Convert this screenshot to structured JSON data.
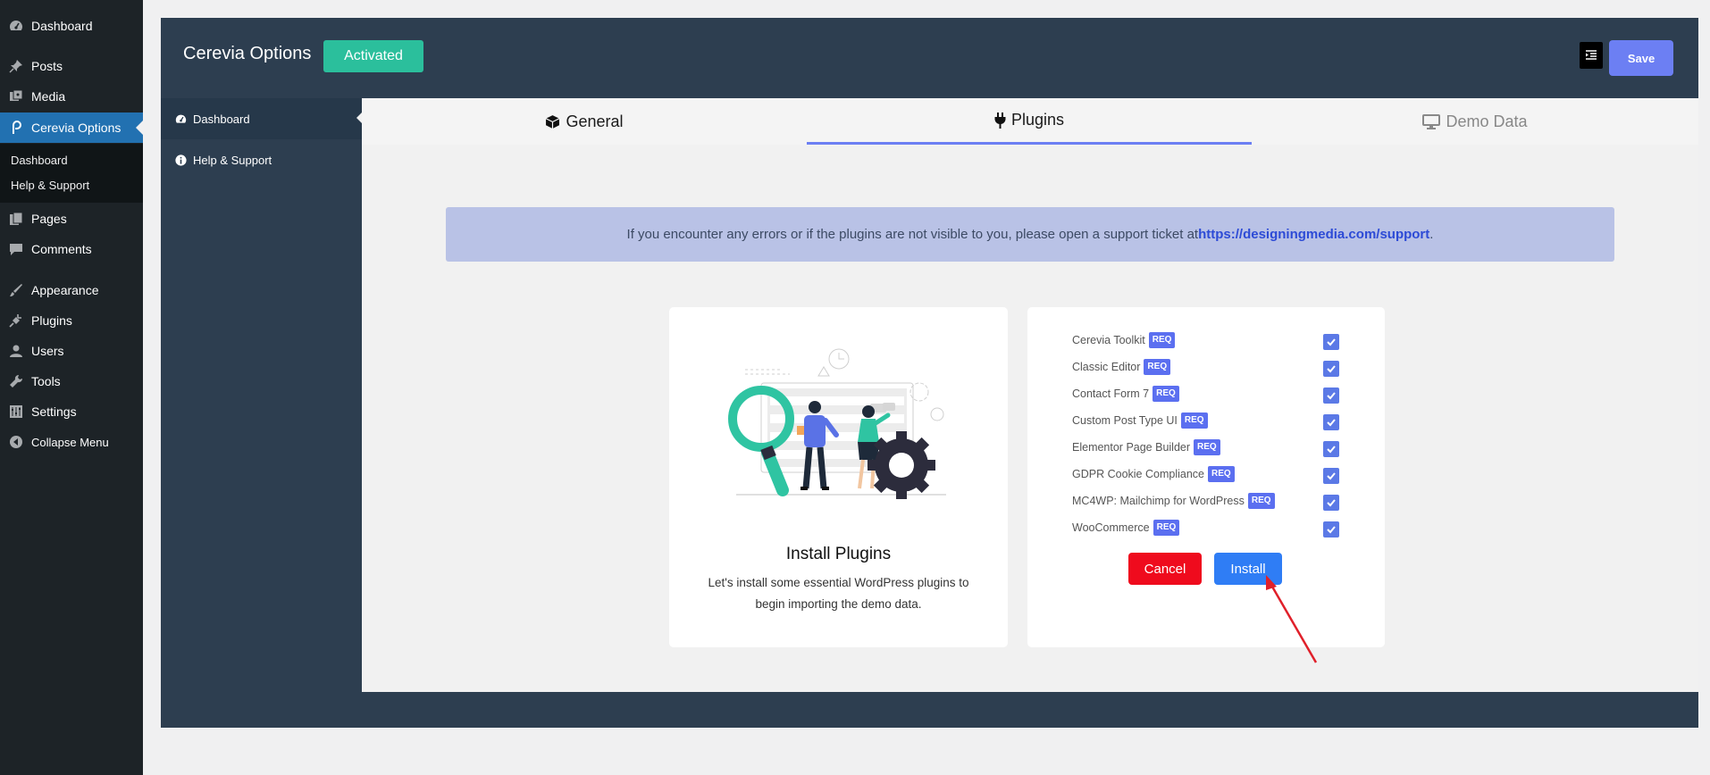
{
  "wp_menu": {
    "items": [
      {
        "label": "Dashboard",
        "icon": "dashboard-icon"
      },
      {
        "label": "Posts",
        "icon": "pin-icon"
      },
      {
        "label": "Media",
        "icon": "media-icon"
      },
      {
        "label": "Cerevia Options",
        "icon": "cerevia-logo-icon"
      },
      {
        "label": "Pages",
        "icon": "pages-icon"
      },
      {
        "label": "Comments",
        "icon": "comment-icon"
      },
      {
        "label": "Appearance",
        "icon": "brush-icon"
      },
      {
        "label": "Plugins",
        "icon": "plug-icon"
      },
      {
        "label": "Users",
        "icon": "user-icon"
      },
      {
        "label": "Tools",
        "icon": "wrench-icon"
      },
      {
        "label": "Settings",
        "icon": "settings-icon"
      },
      {
        "label": "Collapse Menu",
        "icon": "collapse-icon"
      }
    ],
    "submenu": [
      "Dashboard",
      "Help & Support"
    ]
  },
  "panel": {
    "title": "Cerevia Options",
    "status_badge": "Activated",
    "save_label": "Save",
    "sidebar": [
      {
        "label": "Dashboard",
        "icon": "dashboard-icon"
      },
      {
        "label": "Help & Support",
        "icon": "info-icon"
      }
    ],
    "tabs": [
      {
        "label": "General",
        "icon": "cube-icon"
      },
      {
        "label": "Plugins",
        "icon": "plug-icon"
      },
      {
        "label": "Demo Data",
        "icon": "monitor-icon"
      }
    ]
  },
  "notice": {
    "text": "If you encounter any errors or if the plugins are not visible to you, please open a support ticket at ",
    "link": "https://designingmedia.com/support",
    "suffix": "."
  },
  "install_card": {
    "title": "Install Plugins",
    "description": "Let's install some essential WordPress plugins to begin importing the demo data."
  },
  "plugins": [
    {
      "name": "Cerevia Toolkit",
      "tag": "REQ",
      "checked": true
    },
    {
      "name": "Classic Editor",
      "tag": "REQ",
      "checked": true
    },
    {
      "name": "Contact Form 7",
      "tag": "REQ",
      "checked": true
    },
    {
      "name": "Custom Post Type UI",
      "tag": "REQ",
      "checked": true
    },
    {
      "name": "Elementor Page Builder",
      "tag": "REQ",
      "checked": true
    },
    {
      "name": "GDPR Cookie Compliance",
      "tag": "REQ",
      "checked": true
    },
    {
      "name": "MC4WP: Mailchimp for WordPress",
      "tag": "REQ",
      "checked": true
    },
    {
      "name": "WooCommerce",
      "tag": "REQ",
      "checked": true
    }
  ],
  "actions": {
    "cancel": "Cancel",
    "install": "Install"
  },
  "colors": {
    "wp_sidebar": "#1d2327",
    "wp_active": "#2271b1",
    "panel": "#2d3e50",
    "activated": "#2bbf9c",
    "save": "#6c7ff3",
    "cancel": "#ef0b1d",
    "install": "#2f7df5",
    "arrow": "#e0202a"
  }
}
